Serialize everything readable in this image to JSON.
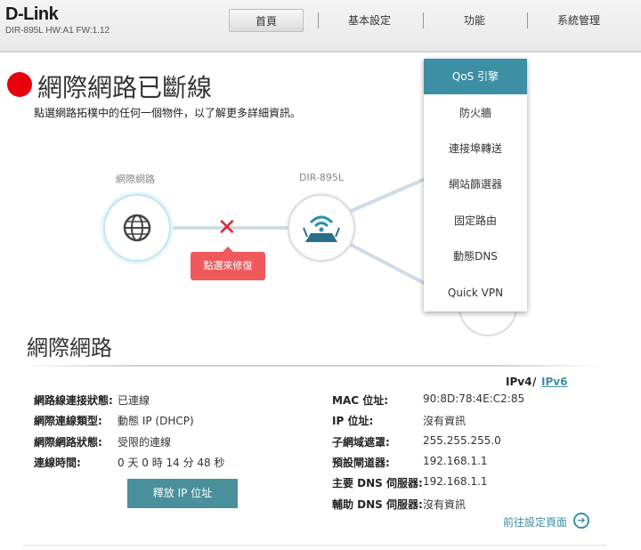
{
  "header": {
    "brand": "D-Link",
    "model_info": "DIR-895L HW:A1 FW:1.12",
    "tabs": [
      "首頁",
      "基本設定",
      "功能",
      "系統管理"
    ]
  },
  "status": {
    "title": "網際網路已斷線",
    "subtitle": "點選網路拓樸中的任何一個物件，以了解更多詳細資訊。",
    "indicator_color": "#e8000d"
  },
  "topology": {
    "internet_label": "網際網路",
    "router_label": "DIR-895L",
    "fix_button": "點選來修復"
  },
  "dropdown": {
    "items": [
      "QoS 引擎",
      "防火牆",
      "連接埠轉送",
      "網站篩選器",
      "固定路由",
      "動態DNS",
      "Quick VPN"
    ],
    "active_color": "#3d8fa3"
  },
  "internet": {
    "section_title": "網際網路",
    "ipv4": "IPv4",
    "ipv_sep": "/",
    "ipv6": "IPv6",
    "left": [
      {
        "label": "網路線連接狀態:",
        "value": "已連線"
      },
      {
        "label": "網際連線類型:",
        "value": "動態 IP (DHCP)"
      },
      {
        "label": "網際網路狀態:",
        "value": "受限的連線"
      },
      {
        "label": "連線時間:",
        "value": "0 天 0 時 14 分 48 秒"
      }
    ],
    "right": [
      {
        "label": "MAC 位址:",
        "value": "90:8D:78:4E:C2:85"
      },
      {
        "label": "IP 位址:",
        "value": "沒有資訊"
      },
      {
        "label": "子網域遮罩:",
        "value": "255.255.255.0"
      },
      {
        "label": "預設閘道器:",
        "value": "192.168.1.1"
      },
      {
        "label": "主要 DNS 伺服器:",
        "value": "192.168.1.1"
      },
      {
        "label": "輔助 DNS 伺服器:",
        "value": "沒有資訊"
      }
    ],
    "release_button": "釋放 IP 位址",
    "goto_link": "前往設定頁面"
  }
}
